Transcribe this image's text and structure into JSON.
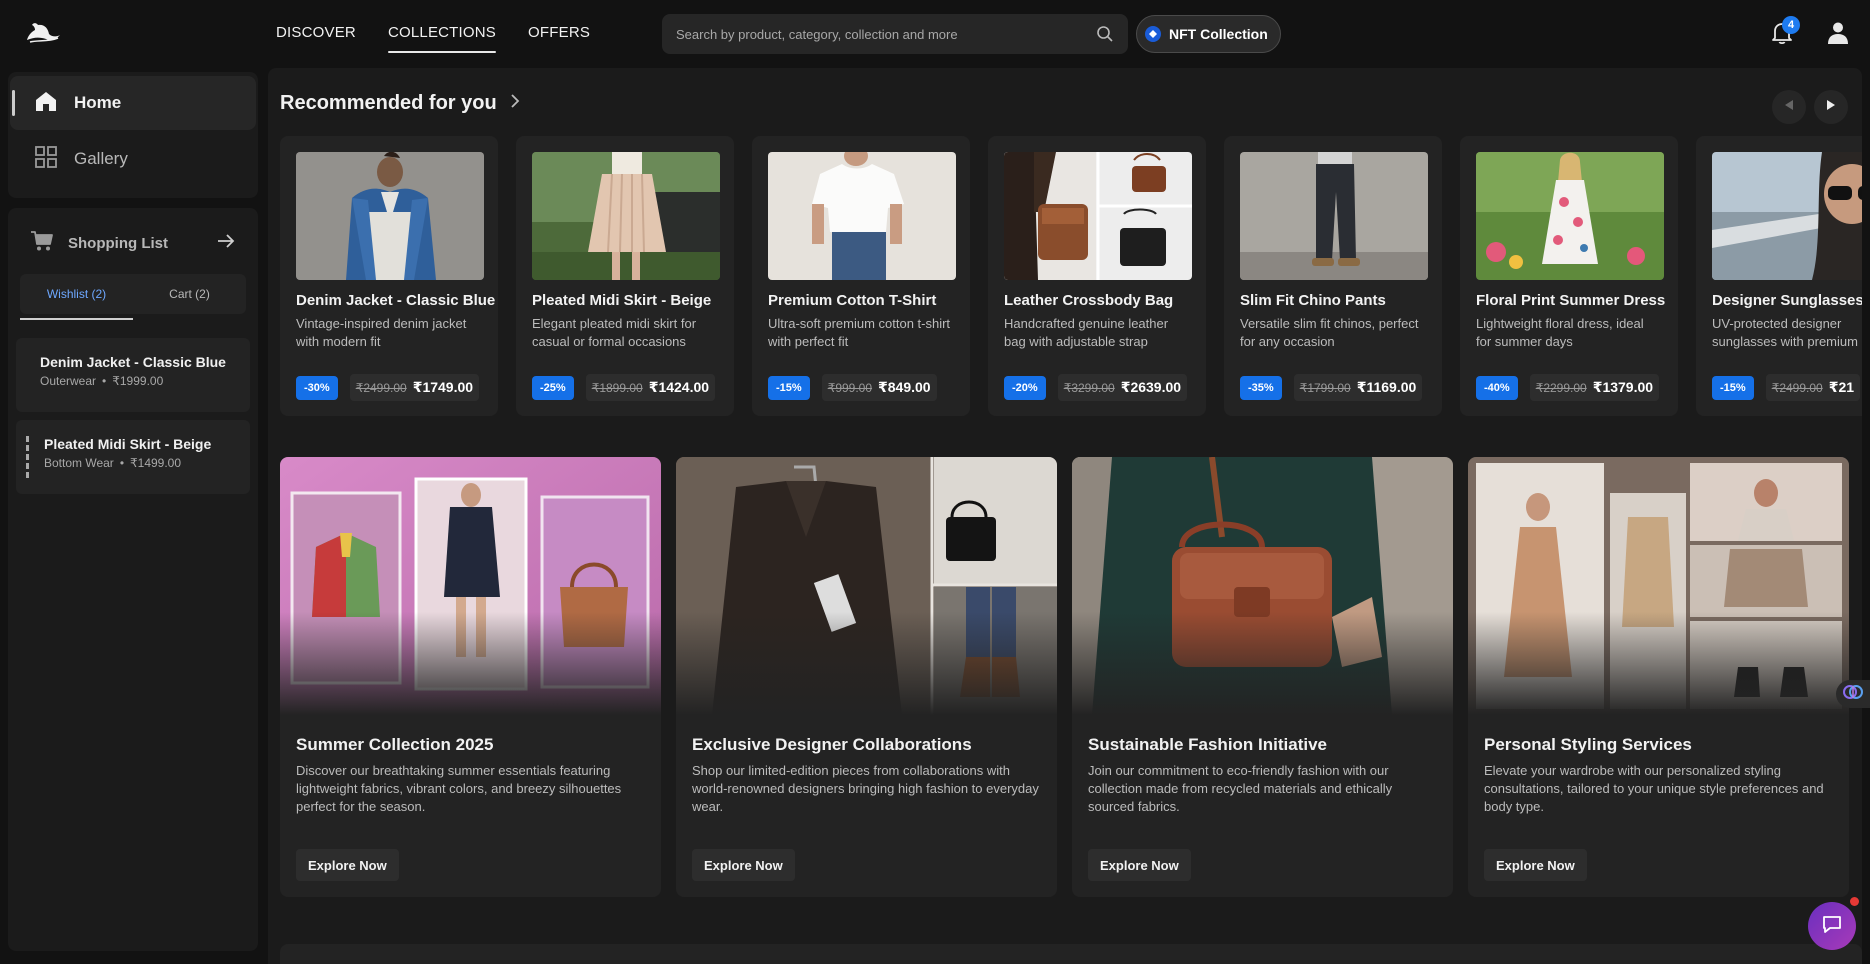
{
  "nav": {
    "items": [
      {
        "label": "DISCOVER",
        "active": false
      },
      {
        "label": "COLLECTIONS",
        "active": true
      },
      {
        "label": "OFFERS",
        "active": false
      }
    ]
  },
  "search": {
    "placeholder": "Search by product, category, collection and more"
  },
  "nft_button": {
    "label": "NFT Collection"
  },
  "notifications": {
    "count": "4"
  },
  "sidebar": {
    "items": [
      {
        "label": "Home",
        "icon": "home-icon",
        "active": true
      },
      {
        "label": "Gallery",
        "icon": "grid-icon",
        "active": false
      }
    ]
  },
  "shopping": {
    "title": "Shopping List",
    "tabs": [
      {
        "label": "Wishlist (2)",
        "active": true
      },
      {
        "label": "Cart (2)",
        "active": false
      }
    ],
    "wishlist": [
      {
        "name": "Denim Jacket - Classic Blue",
        "category": "Outerwear",
        "price": "₹1999.00"
      },
      {
        "name": "Pleated Midi Skirt - Beige",
        "category": "Bottom Wear",
        "price": "₹1499.00"
      }
    ]
  },
  "recommended": {
    "title": "Recommended for you",
    "products": [
      {
        "name": "Denim Jacket - Classic Blue",
        "desc": "Vintage-inspired denim jacket with modern fit",
        "discount": "-30%",
        "old_price": "₹2499.00",
        "price": "₹1749.00"
      },
      {
        "name": "Pleated Midi Skirt - Beige",
        "desc": "Elegant pleated midi skirt for casual or formal occasions",
        "discount": "-25%",
        "old_price": "₹1899.00",
        "price": "₹1424.00"
      },
      {
        "name": "Premium Cotton T-Shirt",
        "desc": "Ultra-soft premium cotton t-shirt with perfect fit",
        "discount": "-15%",
        "old_price": "₹999.00",
        "price": "₹849.00"
      },
      {
        "name": "Leather Crossbody Bag",
        "desc": "Handcrafted genuine leather bag with adjustable strap",
        "discount": "-20%",
        "old_price": "₹3299.00",
        "price": "₹2639.00"
      },
      {
        "name": "Slim Fit Chino Pants",
        "desc": "Versatile slim fit chinos, perfect for any occasion",
        "discount": "-35%",
        "old_price": "₹1799.00",
        "price": "₹1169.00"
      },
      {
        "name": "Floral Print Summer Dress",
        "desc": "Lightweight floral dress, ideal for summer days",
        "discount": "-40%",
        "old_price": "₹2299.00",
        "price": "₹1379.00"
      },
      {
        "name": "Designer Sunglasses",
        "desc": "UV-protected designer sunglasses with premium",
        "discount": "-15%",
        "old_price": "₹2499.00",
        "price": "₹21"
      }
    ]
  },
  "collections": [
    {
      "title": "Summer Collection 2025",
      "desc": "Discover our breathtaking summer essentials featuring lightweight fabrics, vibrant colors, and breezy silhouettes perfect for the season.",
      "button": "Explore Now"
    },
    {
      "title": "Exclusive Designer Collaborations",
      "desc": "Shop our limited-edition pieces from collaborations with world-renowned designers bringing high fashion to everyday wear.",
      "button": "Explore Now"
    },
    {
      "title": "Sustainable Fashion Initiative",
      "desc": "Join our commitment to eco-friendly fashion with our collection made from recycled materials and ethically sourced fabrics.",
      "button": "Explore Now"
    },
    {
      "title": "Personal Styling Services",
      "desc": "Elevate your wardrobe with our personalized styling consultations, tailored to your unique style preferences and body type.",
      "button": "Explore Now"
    }
  ],
  "colors": {
    "accent": "#1570e8",
    "active_tab": "#6ea8ff",
    "background": "#121212",
    "panel": "#1b1b1b",
    "card": "#232323"
  }
}
